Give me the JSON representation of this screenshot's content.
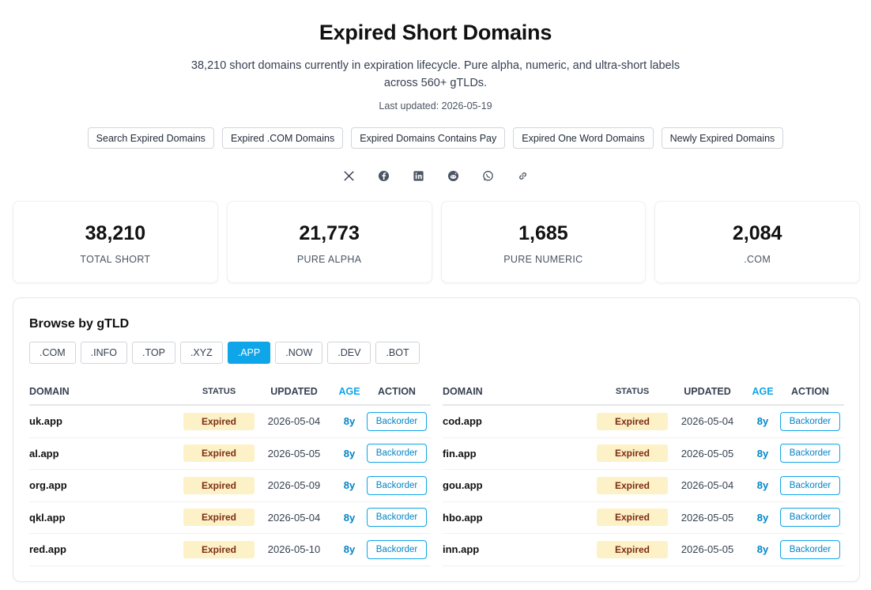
{
  "header": {
    "title": "Expired Short Domains",
    "subtitle": "38,210 short domains currently in expiration lifecycle. Pure alpha, numeric, and ultra-short labels across 560+ gTLDs.",
    "updated": "Last updated: 2026-05-19"
  },
  "links": [
    {
      "label": "Search Expired Domains"
    },
    {
      "label": "Expired .COM Domains"
    },
    {
      "label": "Expired Domains Contains Pay"
    },
    {
      "label": "Expired One Word Domains"
    },
    {
      "label": "Newly Expired Domains"
    }
  ],
  "share": [
    "x-icon",
    "facebook-icon",
    "linkedin-icon",
    "reddit-icon",
    "whatsapp-icon",
    "link-icon"
  ],
  "stats": [
    {
      "value": "38,210",
      "label": "TOTAL SHORT"
    },
    {
      "value": "21,773",
      "label": "PURE ALPHA"
    },
    {
      "value": "1,685",
      "label": "PURE NUMERIC"
    },
    {
      "value": "2,084",
      "label": ".COM"
    }
  ],
  "browse": {
    "title": "Browse by gTLD",
    "tabs": [
      ".COM",
      ".INFO",
      ".TOP",
      ".XYZ",
      ".APP",
      ".NOW",
      ".DEV",
      ".BOT"
    ],
    "active_tab": ".APP",
    "columns": {
      "domain": "DOMAIN",
      "status": "STATUS",
      "updated": "UPDATED",
      "age": "AGE",
      "action": "ACTION"
    },
    "left_rows": [
      {
        "domain": "uk.app",
        "status": "Expired",
        "updated": "2026-05-04",
        "age": "8y",
        "action": "Backorder"
      },
      {
        "domain": "al.app",
        "status": "Expired",
        "updated": "2026-05-05",
        "age": "8y",
        "action": "Backorder"
      },
      {
        "domain": "org.app",
        "status": "Expired",
        "updated": "2026-05-09",
        "age": "8y",
        "action": "Backorder"
      },
      {
        "domain": "qkl.app",
        "status": "Expired",
        "updated": "2026-05-04",
        "age": "8y",
        "action": "Backorder"
      },
      {
        "domain": "red.app",
        "status": "Expired",
        "updated": "2026-05-10",
        "age": "8y",
        "action": "Backorder"
      }
    ],
    "right_rows": [
      {
        "domain": "cod.app",
        "status": "Expired",
        "updated": "2026-05-04",
        "age": "8y",
        "action": "Backorder"
      },
      {
        "domain": "fin.app",
        "status": "Expired",
        "updated": "2026-05-05",
        "age": "8y",
        "action": "Backorder"
      },
      {
        "domain": "gou.app",
        "status": "Expired",
        "updated": "2026-05-04",
        "age": "8y",
        "action": "Backorder"
      },
      {
        "domain": "hbo.app",
        "status": "Expired",
        "updated": "2026-05-05",
        "age": "8y",
        "action": "Backorder"
      },
      {
        "domain": "inn.app",
        "status": "Expired",
        "updated": "2026-05-05",
        "age": "8y",
        "action": "Backorder"
      }
    ]
  },
  "colors": {
    "accent": "#0ea5e9",
    "badge_bg": "#fdf1c7",
    "badge_text": "#7c2d12"
  }
}
